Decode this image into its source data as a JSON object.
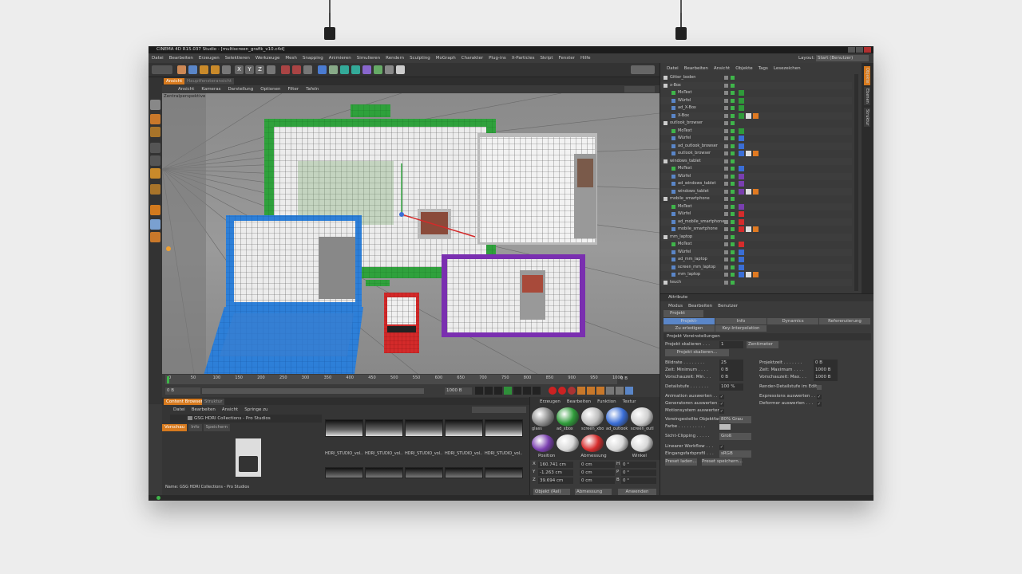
{
  "app": {
    "title": "CINEMA 4D R15.037 Studio - [multiscreen_grafik_v10.c4d]",
    "layout_label": "Layout:",
    "layout_value": "Start (Benutzer)"
  },
  "menu": [
    "Datei",
    "Bearbeiten",
    "Erzeugen",
    "Selektieren",
    "Werkzeuge",
    "Mesh",
    "Snapping",
    "Animieren",
    "Simulieren",
    "Rendern",
    "Sculpting",
    "MoGraph",
    "Charakter",
    "Plug-ins",
    "X-Particles",
    "Skript",
    "Fenster",
    "Hilfe"
  ],
  "toolbar": {
    "x": "X",
    "y": "Y",
    "z": "Z"
  },
  "viewport": {
    "tab_active": "Ansicht",
    "tab_other": "Hauptfensteransicht",
    "menu": [
      "Ansicht",
      "Kameras",
      "Darstellung",
      "Optionen",
      "Filter",
      "Tafeln"
    ],
    "label": "Zentralperspektive"
  },
  "timeline": {
    "ticks": [
      "0",
      "50",
      "100",
      "150",
      "200",
      "250",
      "300",
      "350",
      "400",
      "450",
      "500",
      "550",
      "600",
      "650",
      "700",
      "750",
      "800",
      "850",
      "900",
      "950",
      "1000"
    ],
    "current_frame": "0 B",
    "start": "0 B",
    "end": "1000 B",
    "end_field": "0 B"
  },
  "content_browser": {
    "tab_active": "Content Browser",
    "tab_other": "Struktur",
    "menu": [
      "Datei",
      "Bearbeiten",
      "Ansicht",
      "Springe zu"
    ],
    "path": "GSG HDRI Collections - Pro Studios",
    "subtabs": [
      "Vorschau",
      "Info",
      "Speichern"
    ],
    "name_label": "Name: GSG HDRI Collections - Pro Studios",
    "thumb_labels": [
      "HDRI_STUDIO_vol..",
      "HDRI_STUDIO_vol..",
      "HDRI_STUDIO_vol..",
      "HDRI_STUDIO_vol..",
      "HDRI_STUDIO_vol.."
    ],
    "vertical_brand": "MAXON CINEMA 4D"
  },
  "material_manager": {
    "menu": [
      "Erzeugen",
      "Bearbeiten",
      "Funktion",
      "Textur"
    ],
    "materials": [
      "glass",
      "ad_xbox",
      "screen_xbo",
      "ad_outlook",
      "screen_outl"
    ],
    "mat_colors": [
      "#8c8c8c",
      "#2f9b3a",
      "#bdbdbd",
      "#3a6ed6",
      "#cfcfcf"
    ],
    "mat_colors2": [
      "#7a3fb0",
      "#d8d8d8",
      "#d62c2c",
      "#d8d8d8",
      "#d8d8d8"
    ]
  },
  "coords": {
    "headers": [
      "Position",
      "Abmessung",
      "Winkel"
    ],
    "rows": [
      {
        "axis": "X",
        "pos": "160.741 cm",
        "size": "0 cm",
        "angle_axis": "H",
        "angle": "0 °"
      },
      {
        "axis": "Y",
        "pos": "-1.263 cm",
        "size": "0 cm",
        "angle_axis": "P",
        "angle": "0 °"
      },
      {
        "axis": "Z",
        "pos": "39.694 cm",
        "size": "0 cm",
        "angle_axis": "B",
        "angle": "0 °"
      }
    ],
    "mode_object": "Objekt (Rel)",
    "mode_size": "Abmessung",
    "apply": "Anwenden"
  },
  "object_manager": {
    "menu": [
      "Datei",
      "Bearbeiten",
      "Ansicht",
      "Objekte",
      "Tags",
      "Lesezeichen"
    ],
    "rows": [
      {
        "indent": 0,
        "name": "Gitter_boden",
        "type": "null"
      },
      {
        "indent": 0,
        "name": "x-Box",
        "type": "null"
      },
      {
        "indent": 1,
        "name": "MoText",
        "type": "text"
      },
      {
        "indent": 1,
        "name": "Würfel",
        "type": "cube"
      },
      {
        "indent": 1,
        "name": "ad_X-Box",
        "type": "cube"
      },
      {
        "indent": 1,
        "name": "X-Box",
        "type": "poly"
      },
      {
        "indent": 0,
        "name": "outlook_browser",
        "type": "null"
      },
      {
        "indent": 1,
        "name": "MoText",
        "type": "text"
      },
      {
        "indent": 1,
        "name": "Würfel",
        "type": "cube"
      },
      {
        "indent": 1,
        "name": "ad_outlook_browser",
        "type": "cube"
      },
      {
        "indent": 1,
        "name": "outlook_browser",
        "type": "poly"
      },
      {
        "indent": 0,
        "name": "windows_tablet",
        "type": "null"
      },
      {
        "indent": 1,
        "name": "MoText",
        "type": "text"
      },
      {
        "indent": 1,
        "name": "Würfel",
        "type": "cube"
      },
      {
        "indent": 1,
        "name": "ad_windows_tablet",
        "type": "cube"
      },
      {
        "indent": 1,
        "name": "windows_tablet",
        "type": "poly"
      },
      {
        "indent": 0,
        "name": "mobile_smartphone",
        "type": "null"
      },
      {
        "indent": 1,
        "name": "MoText",
        "type": "text"
      },
      {
        "indent": 1,
        "name": "Würfel",
        "type": "cube"
      },
      {
        "indent": 1,
        "name": "ad_mobile_smartphone",
        "type": "cube"
      },
      {
        "indent": 1,
        "name": "mobile_smartphone",
        "type": "poly"
      },
      {
        "indent": 0,
        "name": "mm_laptop",
        "type": "null"
      },
      {
        "indent": 1,
        "name": "MoText",
        "type": "text"
      },
      {
        "indent": 1,
        "name": "Würfel",
        "type": "cube"
      },
      {
        "indent": 1,
        "name": "ad_mm_laptop",
        "type": "cube"
      },
      {
        "indent": 1,
        "name": "screen_mm_laptop",
        "type": "cube"
      },
      {
        "indent": 1,
        "name": "mm_laptop",
        "type": "poly"
      },
      {
        "indent": 0,
        "name": "teuch",
        "type": "null"
      }
    ],
    "tag_colors": [
      "#2f9b3a",
      "#2f9b3a",
      "#2f9b3a",
      "#2f9b3a",
      "#2f9b3a",
      "#3a6ed6",
      "#3a6ed6",
      "#3a6ed6",
      "#3a6ed6",
      "#7a3fb0",
      "#7a3fb0",
      "#7a3fb0",
      "#7a3fb0",
      "#d62c2c",
      "#d62c2c",
      "#d62c2c",
      "#d62c2c",
      "#3a6ed6",
      "#3a6ed6",
      "#3a6ed6",
      "#3a6ed6",
      "#3a6ed6"
    ],
    "side_tabs": [
      "Objekte",
      "Ebenen",
      "Struktur"
    ]
  },
  "attributes": {
    "title": "Attribute",
    "menu": [
      "Modus",
      "Bearbeiten",
      "Benutzer"
    ],
    "object": "Projekt",
    "tabs": [
      "Projekt-Voreinstellungen",
      "Info",
      "Dynamics",
      "Referenzierung"
    ],
    "tabs2": [
      "Zu erledigen",
      "Key-Interpolation"
    ],
    "section": "Projekt Voreinstellungen",
    "scale_label": "Projekt skalieren . . .",
    "scale_value": "1",
    "scale_unit": "Zentimeter",
    "scale_button": "Projekt skalieren...",
    "left_fields": [
      {
        "label": "Bildrate . . . . . . . .",
        "value": "25"
      },
      {
        "label": "Zeit: Minimum . . . .",
        "value": "0 B"
      },
      {
        "label": "Vorschauzeit: Min. . .",
        "value": "0 B"
      }
    ],
    "right_fields": [
      {
        "label": "Projektzeit . . . . . . .",
        "value": "0 B"
      },
      {
        "label": "Zeit: Maximum . . . .",
        "value": "1000 B"
      },
      {
        "label": "Vorschauzeit: Max. . .",
        "value": "1000 B"
      }
    ],
    "detail_label": "Detailstufe . . . . . . .",
    "detail_value": "100 %",
    "render_detail": "Render-Detailstufe im Editor",
    "checks_left": [
      "Animation auswerten . .",
      "Generatoren auswerten .",
      "Motionsystem auswerten ."
    ],
    "checks_right": [
      "Expressions auswerten . .",
      "Deformer auswerten . . ."
    ],
    "obj_color_label": "Voreingestellte Objektfarbe",
    "obj_color_value": "80% Grau",
    "color_label": "Farbe . . . . . . . . . .",
    "clipping_label": "Sicht-Clipping . . . . .",
    "clipping_value": "Groß",
    "linear_label": "Linearer Workflow . . .",
    "profile_label": "Eingangsfarbprofil . . .",
    "profile_value": "sRGB",
    "load_button": "Preset laden...",
    "save_button": "Preset speichern..."
  }
}
